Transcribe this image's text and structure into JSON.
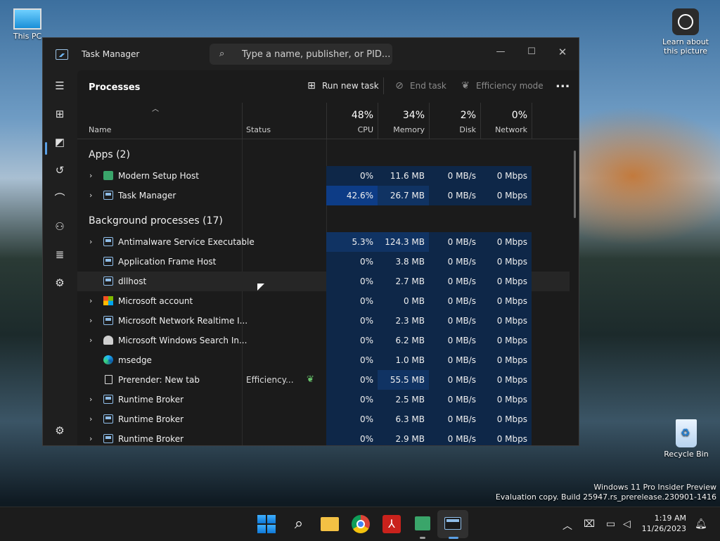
{
  "desktop": {
    "this_pc": "This PC",
    "learn": "Learn about this picture",
    "recycle": "Recycle Bin",
    "watermark_line1": "Windows 11 Pro Insider Preview",
    "watermark_line2": "Evaluation copy. Build 25947.rs_prerelease.230901-1416"
  },
  "window": {
    "title": "Task Manager",
    "search_placeholder": "Type a name, publisher, or PID..."
  },
  "toolbar": {
    "page_title": "Processes",
    "run_new_task": "Run new task",
    "end_task": "End task",
    "efficiency_mode": "Efficiency mode",
    "more": "..."
  },
  "header": {
    "name": "Name",
    "status": "Status",
    "cpu_pct": "48%",
    "cpu": "CPU",
    "mem_pct": "34%",
    "mem": "Memory",
    "disk_pct": "2%",
    "disk": "Disk",
    "net_pct": "0%",
    "net": "Network"
  },
  "groups": {
    "apps": "Apps (2)",
    "background": "Background processes (17)"
  },
  "apps": [
    {
      "name": "Modern Setup Host",
      "status": "",
      "cpu": "0%",
      "mem": "11.6 MB",
      "disk": "0 MB/s",
      "net": "0 Mbps"
    },
    {
      "name": "Task Manager",
      "status": "",
      "cpu": "42.6%",
      "mem": "26.7 MB",
      "disk": "0 MB/s",
      "net": "0 Mbps"
    }
  ],
  "background": [
    {
      "name": "Antimalware Service Executable",
      "status": "",
      "cpu": "5.3%",
      "mem": "124.3 MB",
      "disk": "0 MB/s",
      "net": "0 Mbps"
    },
    {
      "name": "Application Frame Host",
      "status": "",
      "cpu": "0%",
      "mem": "3.8 MB",
      "disk": "0 MB/s",
      "net": "0 Mbps"
    },
    {
      "name": "dllhost",
      "status": "",
      "cpu": "0%",
      "mem": "2.7 MB",
      "disk": "0 MB/s",
      "net": "0 Mbps"
    },
    {
      "name": "Microsoft account",
      "status": "",
      "cpu": "0%",
      "mem": "0 MB",
      "disk": "0 MB/s",
      "net": "0 Mbps"
    },
    {
      "name": "Microsoft Network Realtime I...",
      "status": "",
      "cpu": "0%",
      "mem": "2.3 MB",
      "disk": "0 MB/s",
      "net": "0 Mbps"
    },
    {
      "name": "Microsoft Windows Search In...",
      "status": "",
      "cpu": "0%",
      "mem": "6.2 MB",
      "disk": "0 MB/s",
      "net": "0 Mbps"
    },
    {
      "name": "msedge",
      "status": "",
      "cpu": "0%",
      "mem": "1.0 MB",
      "disk": "0 MB/s",
      "net": "0 Mbps"
    },
    {
      "name": "Prerender: New tab",
      "status": "Efficiency...",
      "cpu": "0%",
      "mem": "55.5 MB",
      "disk": "0 MB/s",
      "net": "0 Mbps"
    },
    {
      "name": "Runtime Broker",
      "status": "",
      "cpu": "0%",
      "mem": "2.5 MB",
      "disk": "0 MB/s",
      "net": "0 Mbps"
    },
    {
      "name": "Runtime Broker",
      "status": "",
      "cpu": "0%",
      "mem": "6.3 MB",
      "disk": "0 MB/s",
      "net": "0 Mbps"
    },
    {
      "name": "Runtime Broker",
      "status": "",
      "cpu": "0%",
      "mem": "2.9 MB",
      "disk": "0 MB/s",
      "net": "0 Mbps"
    }
  ],
  "taskbar": {
    "time": "1:19 AM",
    "date": "11/26/2023"
  },
  "colors": {
    "accent": "#5aa0e6",
    "heat_low": "#0e2748",
    "heat_high": "#0d3c86"
  }
}
